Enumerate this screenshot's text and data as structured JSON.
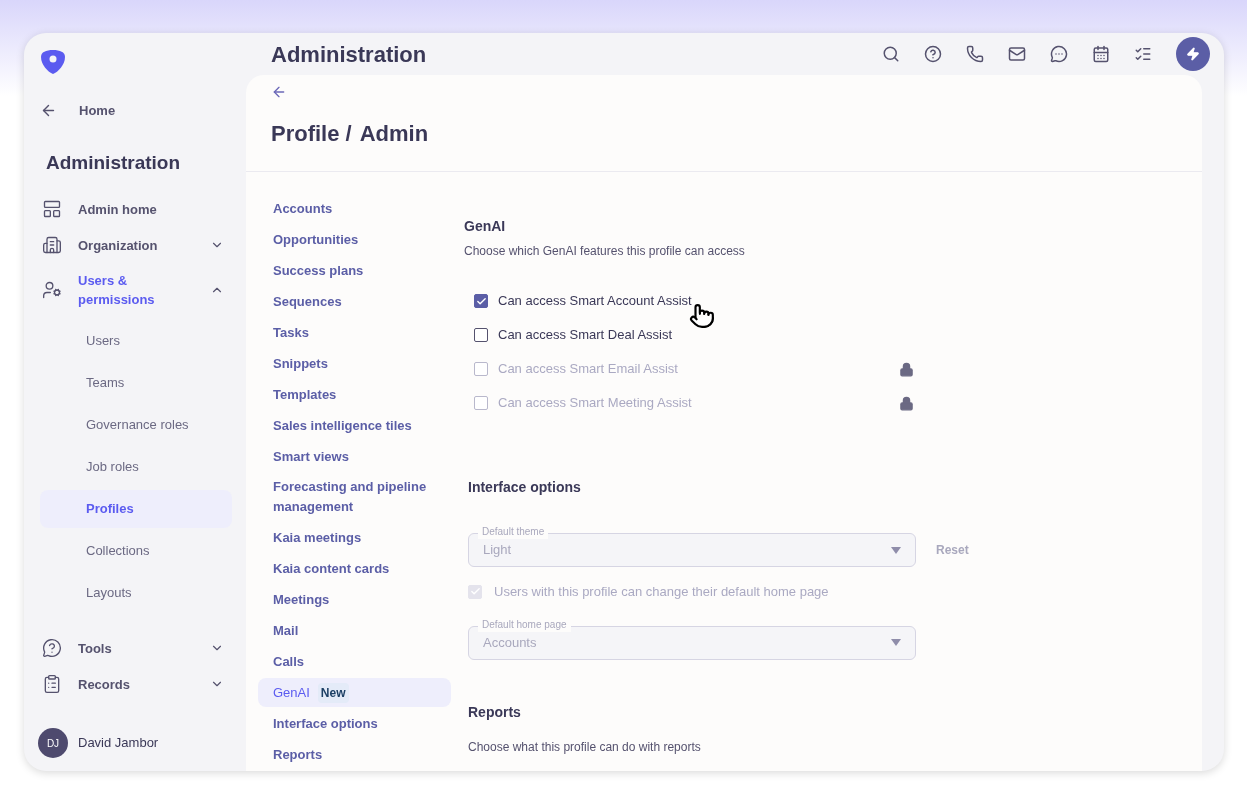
{
  "sidebar": {
    "back": {
      "label": "Home"
    },
    "title": "Administration",
    "items": [
      {
        "label": "Admin home",
        "selected": false
      },
      {
        "label": "Organization",
        "expanded": false,
        "selected": false
      },
      {
        "label": "Users & permissions",
        "expanded": true,
        "selected": true,
        "children": [
          {
            "label": "Users",
            "selected": false
          },
          {
            "label": "Teams",
            "selected": false
          },
          {
            "label": "Governance roles",
            "selected": false
          },
          {
            "label": "Job roles",
            "selected": false
          },
          {
            "label": "Profiles",
            "selected": true
          },
          {
            "label": "Collections",
            "selected": false
          },
          {
            "label": "Layouts",
            "selected": false
          }
        ]
      },
      {
        "label": "Tools",
        "expanded": false,
        "selected": false
      },
      {
        "label": "Records",
        "expanded": false,
        "selected": false
      }
    ],
    "user": {
      "initials": "DJ",
      "name": "David Jambor"
    }
  },
  "header": {
    "title": "Administration"
  },
  "page": {
    "breadcrumb": [
      "Profile /",
      "Admin"
    ],
    "subnav": [
      {
        "label": "Accounts",
        "selected": false
      },
      {
        "label": "Opportunities",
        "selected": false
      },
      {
        "label": "Success plans",
        "selected": false
      },
      {
        "label": "Sequences",
        "selected": false
      },
      {
        "label": "Tasks",
        "selected": false
      },
      {
        "label": "Snippets",
        "selected": false
      },
      {
        "label": "Templates",
        "selected": false
      },
      {
        "label": "Sales intelligence tiles",
        "selected": false
      },
      {
        "label": "Smart views",
        "selected": false
      },
      {
        "label": "Forecasting and pipeline management",
        "selected": false
      },
      {
        "label": "Kaia meetings",
        "selected": false
      },
      {
        "label": "Kaia content cards",
        "selected": false
      },
      {
        "label": "Meetings",
        "selected": false
      },
      {
        "label": "Mail",
        "selected": false
      },
      {
        "label": "Calls",
        "selected": false
      },
      {
        "label": "GenAI",
        "badge": "New",
        "selected": true
      },
      {
        "label": "Interface options",
        "selected": false
      },
      {
        "label": "Reports",
        "selected": false
      }
    ],
    "genai": {
      "title": "GenAI",
      "description": "Choose which GenAI features this profile can access",
      "options": [
        {
          "label": "Can access Smart Account Assist",
          "checked": true,
          "disabled": false,
          "locked": false
        },
        {
          "label": "Can access Smart Deal Assist",
          "checked": false,
          "disabled": false,
          "locked": false
        },
        {
          "label": "Can access Smart Email Assist",
          "checked": false,
          "disabled": true,
          "locked": true
        },
        {
          "label": "Can access Smart Meeting Assist",
          "checked": false,
          "disabled": true,
          "locked": true
        }
      ]
    },
    "interface": {
      "title": "Interface options",
      "theme": {
        "label": "Default theme",
        "value": "Light",
        "disabled": true
      },
      "reset": "Reset",
      "home_option": {
        "label": "Users with this profile can change their default home page",
        "checked": true,
        "disabled": true
      },
      "home_page": {
        "label": "Default home page",
        "value": "Accounts",
        "disabled": true
      }
    },
    "reports": {
      "title": "Reports",
      "description": "Choose what this profile can do with reports"
    }
  }
}
